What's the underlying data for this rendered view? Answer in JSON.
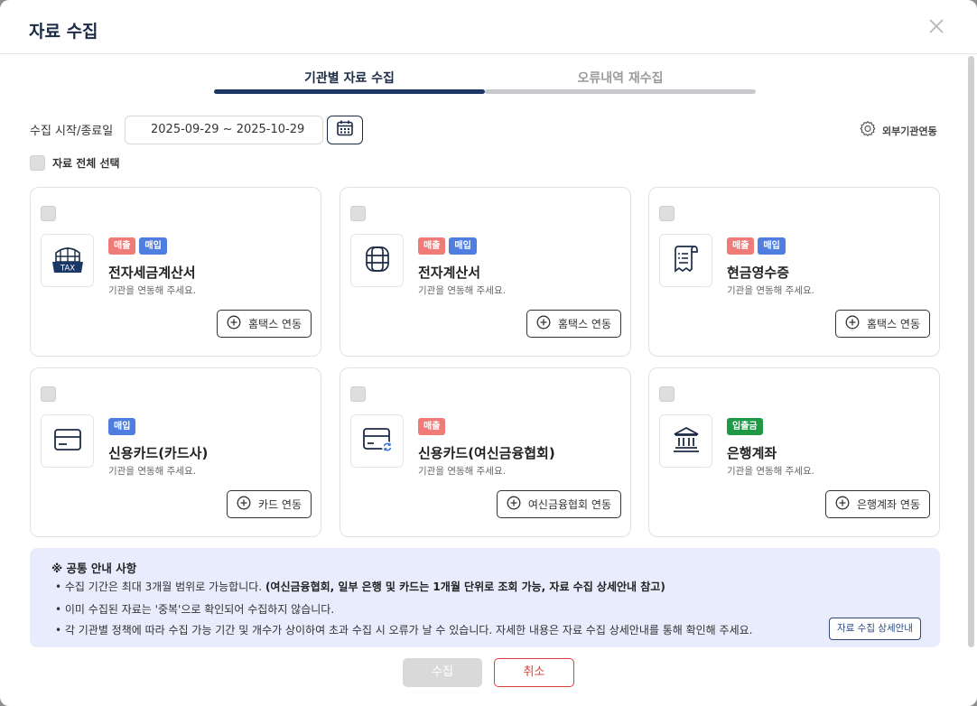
{
  "header": {
    "title": "자료 수집"
  },
  "tabs": [
    {
      "label": "기관별 자료 수집",
      "active": true
    },
    {
      "label": "오류내역 재수집",
      "active": false
    }
  ],
  "filter": {
    "date_label": "수집 시작/종료일",
    "date_value": "2025-09-29 ~ 2025-10-29",
    "external_label": "외부기관연동",
    "select_all_label": "자료 전체 선택"
  },
  "cards": [
    {
      "icon": "tax-invoice-icon",
      "badges": [
        "매출",
        "매입"
      ],
      "title": "전자세금계산서",
      "sub": "기관을 연동해 주세요.",
      "button": "홈택스 연동"
    },
    {
      "icon": "invoice-stack-icon",
      "badges": [
        "매출",
        "매입"
      ],
      "title": "전자계산서",
      "sub": "기관을 연동해 주세요.",
      "button": "홈택스 연동"
    },
    {
      "icon": "receipt-icon",
      "badges": [
        "매출",
        "매입"
      ],
      "title": "현금영수증",
      "sub": "기관을 연동해 주세요.",
      "button": "홈택스 연동"
    },
    {
      "icon": "credit-card-icon",
      "badges": [
        "매입"
      ],
      "title": "신용카드(카드사)",
      "sub": "기관을 연동해 주세요.",
      "button": "카드 연동"
    },
    {
      "icon": "card-sync-icon",
      "badges": [
        "매출"
      ],
      "title": "신용카드(여신금융협회)",
      "sub": "기관을 연동해 주세요.",
      "button": "여신금융협회 연동"
    },
    {
      "icon": "bank-icon",
      "badges": [
        "입출금"
      ],
      "title": "은행계좌",
      "sub": "기관을 연동해 주세요.",
      "button": "은행계좌 연동"
    }
  ],
  "notice": {
    "title": "※ 공통 안내 사항",
    "line1": "• 수집 기간은 최대 3개월 범위로 가능합니다.",
    "line1_bold": "(여신금융협회, 일부 은행 및 카드는 1개월 단위로 조회 가능, 자료 수집 상세안내 참고)",
    "line2": "• 이미 수집된 자료는 '중복'으로 확인되어 수집하지 않습니다.",
    "line3": "• 각 기관별 정책에 따라 수집 가능 기간 및 개수가 상이하여 초과 수집 시 오류가 날 수 있습니다. 자세한 내용은 자료 수집 상세안내를 통해 확인해 주세요.",
    "detail_button": "자료 수집 상세안내"
  },
  "footer": {
    "submit": "수집",
    "cancel": "취소"
  },
  "colors": {
    "navy": "#1a3766",
    "sales": "#ef7b78",
    "purchase": "#4f7de0",
    "inout": "#1e9a46",
    "cancel": "#d9423c"
  }
}
